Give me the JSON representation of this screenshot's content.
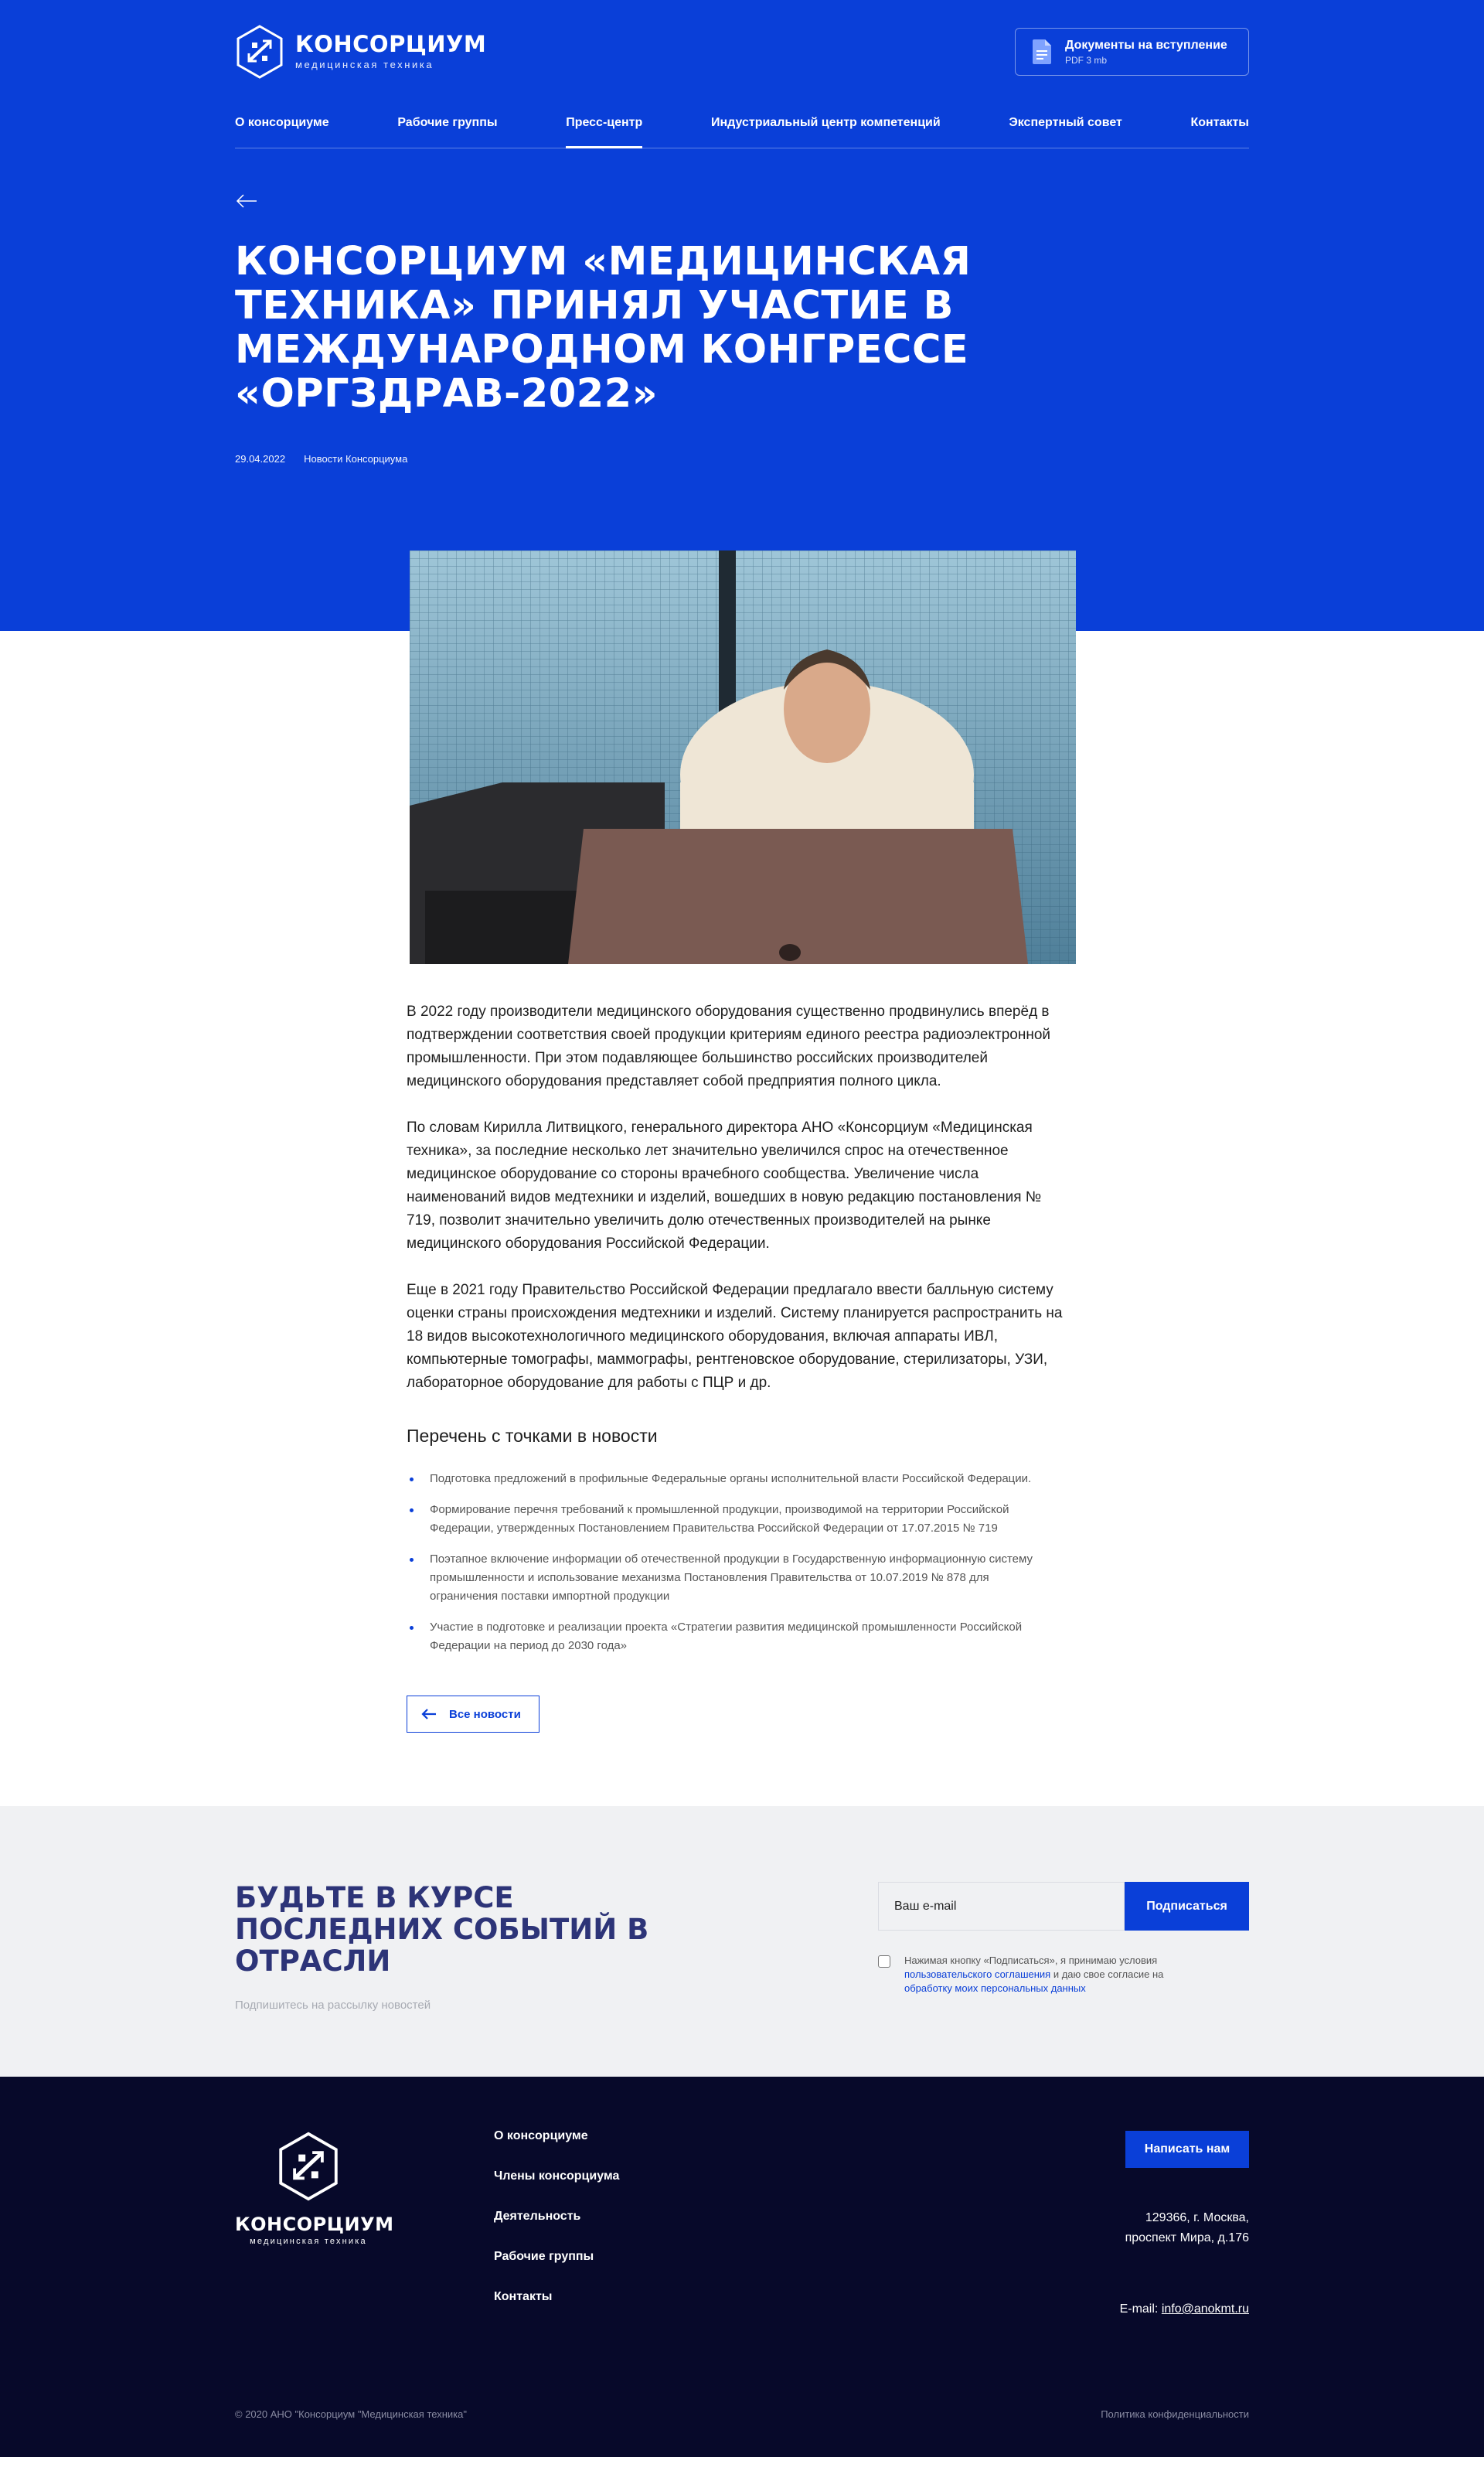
{
  "header": {
    "logo_name": "КОНСОРЦИУМ",
    "logo_sub": "медицинская техника",
    "doc_title": "Документы на вступление",
    "doc_meta": "PDF 3 mb"
  },
  "nav": {
    "items": [
      "О консорциуме",
      "Рабочие группы",
      "Пресс-центр",
      "Индустриальный центр компетенций",
      "Экспертный совет",
      "Контакты"
    ],
    "active": "Пресс-центр"
  },
  "article": {
    "title": "КОНСОРЦИУМ «МЕДИЦИНСКАЯ ТЕХНИКА» ПРИНЯЛ УЧАСТИЕ В МЕЖДУНАРОДНОМ КОНГРЕССЕ «ОРГЗДРАВ-2022»",
    "date": "29.04.2022",
    "category": "Новости Консорциума",
    "paragraphs": [
      "В 2022 году производители медицинского оборудования существенно продвинулись вперёд в подтверждении соответствия своей продукции критериям единого реестра радиоэлектронной промышленности. При этом подавляющее большинство российских производителей медицинского оборудования представляет собой предприятия полного цикла.",
      "По словам Кирилла Литвицкого, генерального директора АНО «Консорциум «Медицинская техника», за последние несколько лет значительно увеличился спрос на отечественное медицинское оборудование со стороны врачебного сообщества. Увеличение числа наименований видов медтехники и изделий, вошедших в новую редакцию постановления № 719, позволит значительно увеличить долю отечественных производителей на рынке медицинского оборудования Российской Федерации.",
      "Еще в 2021 году Правительство Российской Федерации предлагало ввести балльную систему оценки страны происхождения медтехники и изделий. Систему планируется распространить на 18 видов высокотехнологичного медицинского оборудования, включая аппараты ИВЛ, компьютерные томографы, маммографы, рентгеновское оборудование, стерилизаторы, УЗИ, лабораторное оборудование для работы с ПЦР и др."
    ],
    "list_title": "Перечень с точками в новости",
    "list_items": [
      "Подготовка предложений в профильные Федеральные органы исполнительной власти Российской Федерации.",
      "Формирование перечня требований к промышленной продукции, производимой на территории Российской Федерации, утвержденных Постановлением Правительства Российской Федерации от 17.07.2015 № 719",
      "Поэтапное включение информации об отечественной продукции в Государственную информационную систему промышленности и использование механизма Постановления Правительства от 10.07.2019 № 878 для ограничения поставки импортной продукции",
      "Участие в подготовке и реализации проекта «Стратегии развития медицинской промышленности Российской Федерации на период до 2030 года»"
    ],
    "all_news": "Все новости"
  },
  "subscribe": {
    "title": "БУДЬТЕ В КУРСЕ ПОСЛЕДНИХ СОБЫТИЙ В ОТРАСЛИ",
    "hint": "Подпишитесь на рассылку новостей",
    "placeholder": "Ваш e-mail",
    "button": "Подписаться",
    "agree_pre": "Нажимая кнопку «Подписаться», я принимаю условия",
    "agree_link1": "пользовательского соглашения",
    "agree_mid": "и даю свое согласие на",
    "agree_link2": "обработку моих персональных данных"
  },
  "footer": {
    "logo_name": "КОНСОРЦИУМ",
    "logo_sub": "медицинская техника",
    "nav": [
      "О консорциуме",
      "Члены консорциума",
      "Деятельность",
      "Рабочие группы",
      "Контакты"
    ],
    "write_us": "Написать нам",
    "address_line1": "129366, г. Москва,",
    "address_line2": "проспект Мира, д.176",
    "email_label": "E-mail:",
    "email": "info@anokmt.ru",
    "copyright": "© 2020 АНО \"Консорциум \"Медицинская техника\"",
    "policy": "Политика конфиденциальности"
  },
  "colors": {
    "brand_blue": "#0a3fd8",
    "footer_bg": "#07092a",
    "subscribe_bg": "#f0f1f3",
    "title_dark": "#2d3478"
  }
}
